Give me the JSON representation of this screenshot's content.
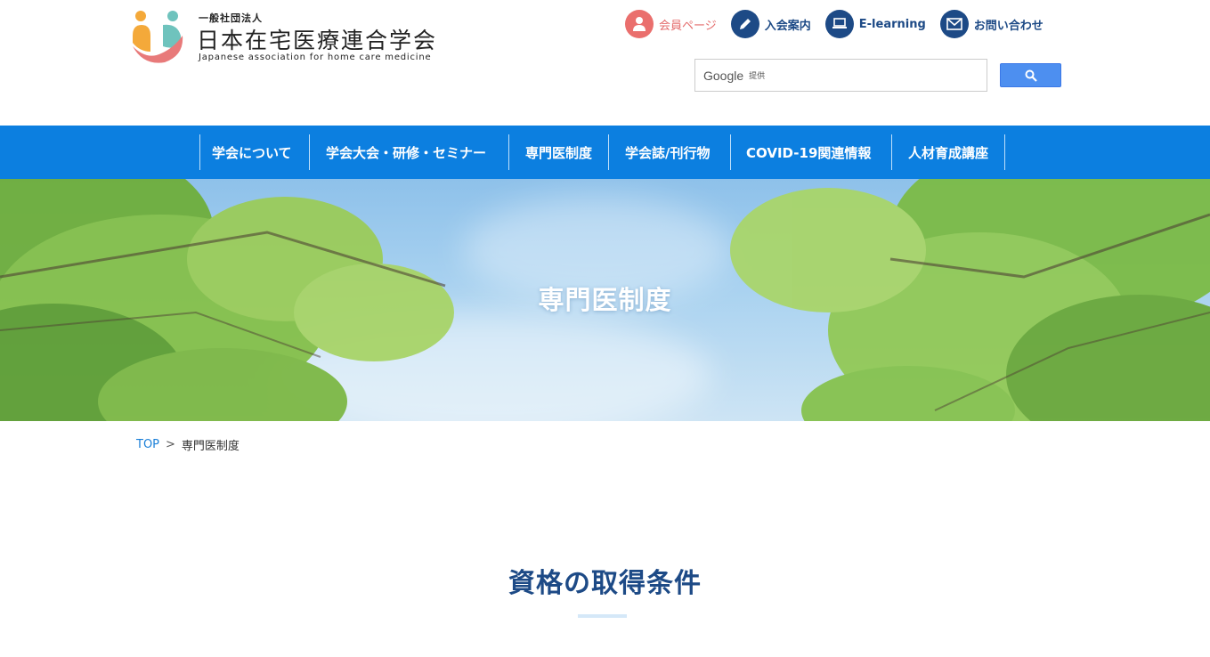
{
  "header": {
    "logo": {
      "small": "一般社団法人",
      "main": "日本在宅医療連合学会",
      "en": "Japanese association for home care medicine"
    },
    "top_links": [
      {
        "label": "会員ページ",
        "icon": "person-icon"
      },
      {
        "label": "入会案内",
        "icon": "pencil-icon"
      },
      {
        "label": "E-learning",
        "icon": "laptop-icon"
      },
      {
        "label": "お問い合わせ",
        "icon": "mail-icon"
      }
    ],
    "search": {
      "brand": "Google",
      "provided": "提供",
      "button_icon": "search-icon"
    }
  },
  "nav": {
    "items": [
      {
        "label": "学会について"
      },
      {
        "label": "学会大会・研修・セミナー"
      },
      {
        "label": "専門医制度"
      },
      {
        "label": "学会誌/刊行物"
      },
      {
        "label": "COVID-19関連情報"
      },
      {
        "label": "人材育成講座"
      }
    ]
  },
  "hero": {
    "title": "専門医制度"
  },
  "breadcrumb": {
    "home": "TOP",
    "separator": ">",
    "current": "専門医制度"
  },
  "main": {
    "section_title": "資格の取得条件"
  },
  "colors": {
    "nav_bg": "#0c7fe0",
    "brand_navy": "#1d4a86",
    "member_red": "#ea6f6d",
    "search_button": "#4d8ff0"
  }
}
